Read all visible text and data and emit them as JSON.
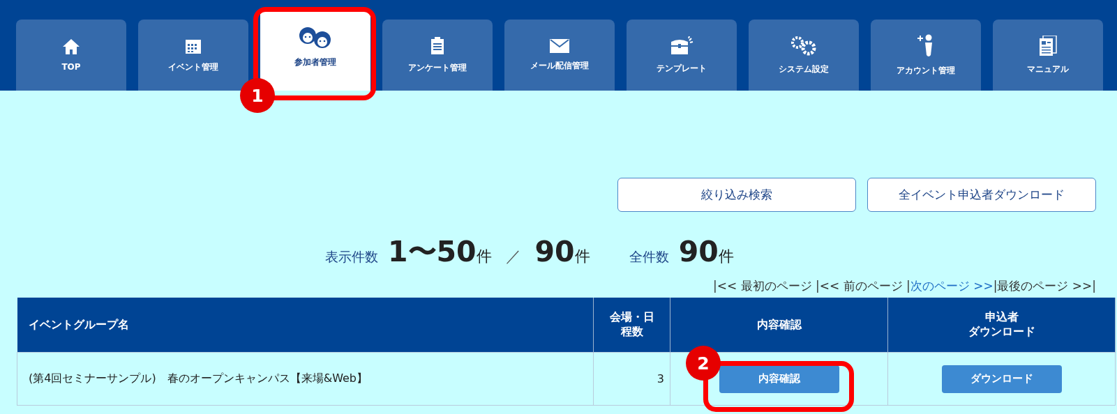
{
  "nav_tabs": [
    {
      "label": "TOP",
      "selected": false
    },
    {
      "label": "イベント管理",
      "selected": false
    },
    {
      "label": "参加者管理",
      "selected": true
    },
    {
      "label": "アンケート管理",
      "selected": false
    },
    {
      "label": "メール配信管理",
      "selected": false
    },
    {
      "label": "テンプレート",
      "selected": false
    },
    {
      "label": "システム設定",
      "selected": false
    },
    {
      "label": "アカウント管理",
      "selected": false
    },
    {
      "label": "マニュアル",
      "selected": false
    }
  ],
  "actions": [
    "絞り込み検索",
    "全イベント申込者ダウンロード"
  ],
  "counts": {
    "shown_label": "表示件数",
    "shown_range": "1〜50",
    "unit_1": "件",
    "separator": "／",
    "shown_total": "90",
    "unit_2": "件",
    "total_label": "全件数",
    "total": "90",
    "unit_3": "件"
  },
  "pager": [
    {
      "text": "|<< 最初のページ |",
      "link": false
    },
    {
      "text": "<< 前のページ |",
      "link": false
    },
    {
      "text": "次のページ >>",
      "link": true
    },
    {
      "text": "|最後のページ >>|",
      "link": false
    }
  ],
  "table": {
    "columns": [
      [
        "イベントグループ名"
      ],
      [
        "会場・日",
        "程数"
      ],
      [
        "内容確認"
      ],
      [
        "申込者",
        "ダウンロード"
      ]
    ],
    "rows": [
      {
        "name": "(第4回セミナーサンプル)　春のオープンキャンパス【来場&Web】",
        "count": "3",
        "view_button": "内容確認",
        "download_button": "ダウンロード"
      }
    ]
  },
  "callouts": [
    "1",
    "2"
  ]
}
